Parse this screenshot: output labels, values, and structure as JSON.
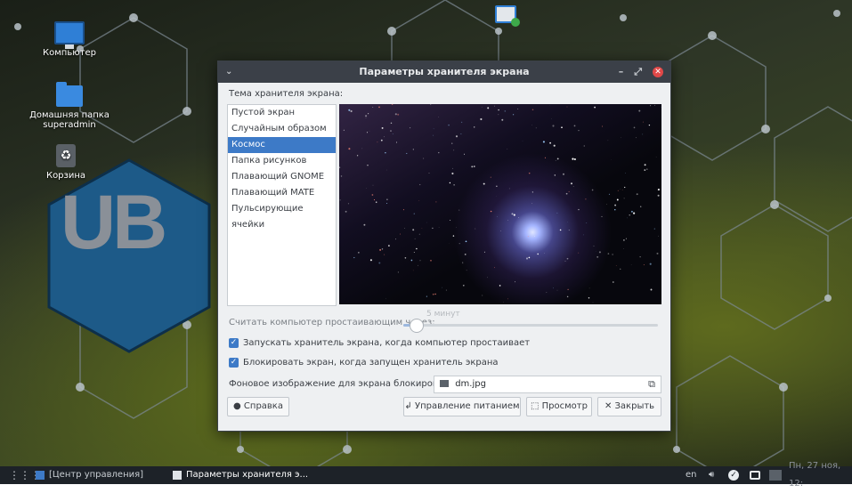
{
  "desktop": {
    "icons": [
      {
        "label": "Компьютер",
        "icon": "computer-icon"
      },
      {
        "label": "Домашняя папка superadmin",
        "icon": "home-folder-icon"
      },
      {
        "label": "Корзина",
        "icon": "trash-icon"
      }
    ],
    "logo_text": "UB"
  },
  "window": {
    "title": "Параметры хранителя экрана",
    "controls": {
      "minimize": "–",
      "maximize": "⤢",
      "close": "✕"
    },
    "theme_label": "Тема хранителя экрана:",
    "themes": [
      "Пустой экран",
      "Случайным образом",
      "Космос",
      "Папка рисунков",
      "Плавающий GNOME",
      "Плавающий MATE",
      "Пульсирующие ячейки"
    ],
    "selected_theme": "Космос",
    "idle_label": "Считать компьютер простаивающим через:",
    "idle_value": "5 минут",
    "idle_fraction": 0.05,
    "activate_label": "Запускать хранитель экрана, когда компьютер простаивает",
    "activate_checked": true,
    "lock_label": "Блокировать экран, когда запущен хранитель экрана",
    "lock_checked": true,
    "bg_image_label": "Фоновое изображение для экрана блокировки:",
    "bg_image_value": "dm.jpg",
    "buttons": {
      "help": "Справка",
      "power": "Управление питанием",
      "preview": "Просмотр",
      "close": "Закрыть"
    }
  },
  "taskbar": {
    "control_center": "[Центр управления]",
    "active_window": "Параметры хранителя э...",
    "keyboard_layout": "en",
    "datetime": "Пн, 27 ноя, 12:"
  },
  "colors": {
    "accent": "#3d7ac7",
    "titlebar": "#3b4048",
    "close": "#e04848"
  }
}
